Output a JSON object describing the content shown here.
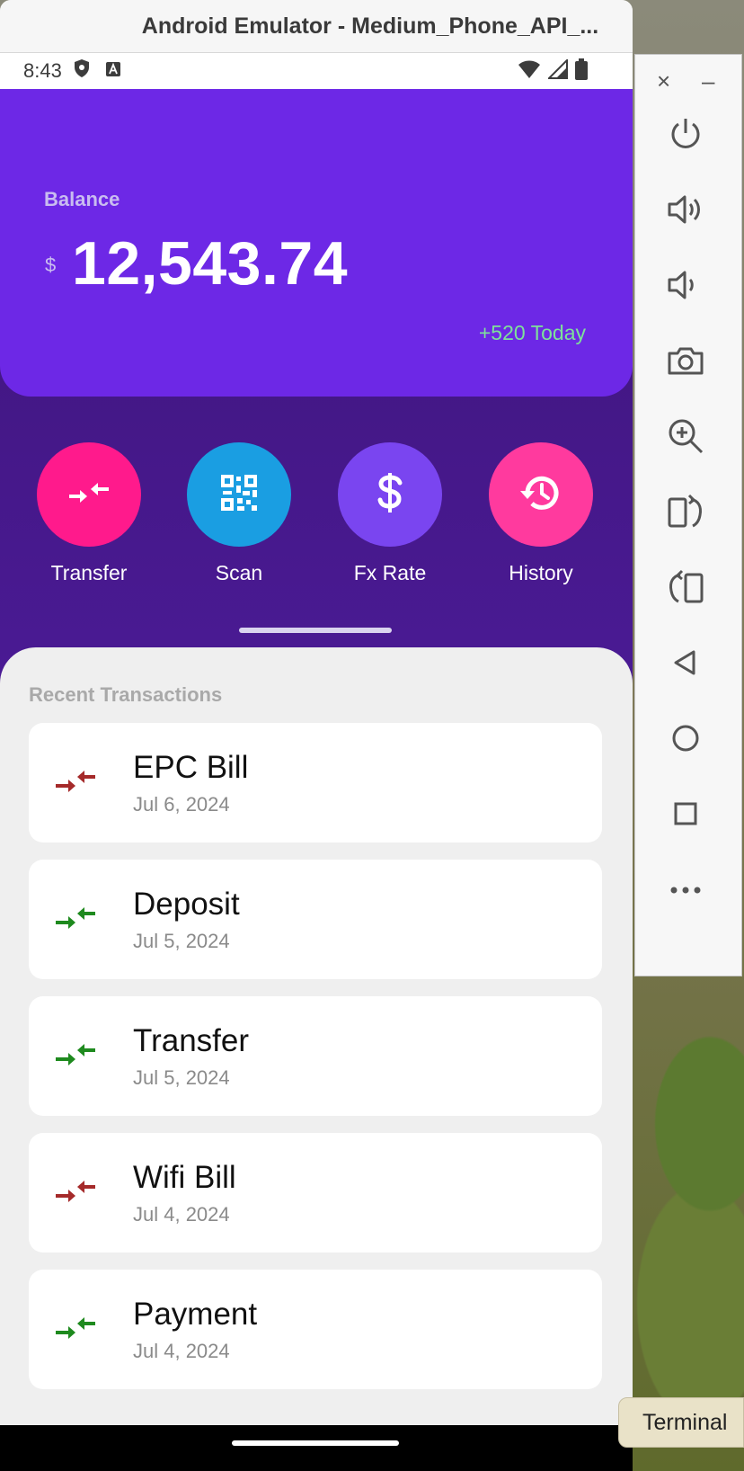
{
  "window": {
    "title": "Android Emulator - Medium_Phone_API_..."
  },
  "statusbar": {
    "time": "8:43"
  },
  "balance": {
    "label": "Balance",
    "currency": "$",
    "amount": "12,543.74",
    "change": "+520 Today"
  },
  "actions": [
    {
      "label": "Transfer",
      "icon": "transfer-icon",
      "color": "#ff1a8c"
    },
    {
      "label": "Scan",
      "icon": "qr-code-icon",
      "color": "#1a9ee2"
    },
    {
      "label": "Fx Rate",
      "icon": "dollar-icon",
      "color": "#7a45f0"
    },
    {
      "label": "History",
      "icon": "history-icon",
      "color": "#ff3a9e"
    }
  ],
  "transactions": {
    "title": "Recent Transactions",
    "items": [
      {
        "name": "EPC Bill",
        "date": "Jul 6, 2024",
        "direction": "out",
        "color": "#a52a2a"
      },
      {
        "name": "Deposit",
        "date": "Jul 5, 2024",
        "direction": "in",
        "color": "#1e8a1e"
      },
      {
        "name": "Transfer",
        "date": "Jul 5, 2024",
        "direction": "in",
        "color": "#1e8a1e"
      },
      {
        "name": "Wifi Bill",
        "date": "Jul 4, 2024",
        "direction": "out",
        "color": "#a52a2a"
      },
      {
        "name": "Payment",
        "date": "Jul 4, 2024",
        "direction": "in",
        "color": "#1e8a1e"
      }
    ]
  },
  "toolbar": {
    "close": "×",
    "minimize": "–",
    "buttons": [
      "power-icon",
      "volume-up-icon",
      "volume-down-icon",
      "camera-icon",
      "zoom-icon",
      "rotate-left-icon",
      "rotate-right-icon",
      "back-icon",
      "home-icon",
      "overview-icon",
      "more-icon"
    ]
  },
  "dock": {
    "terminal_label": "Terminal"
  }
}
